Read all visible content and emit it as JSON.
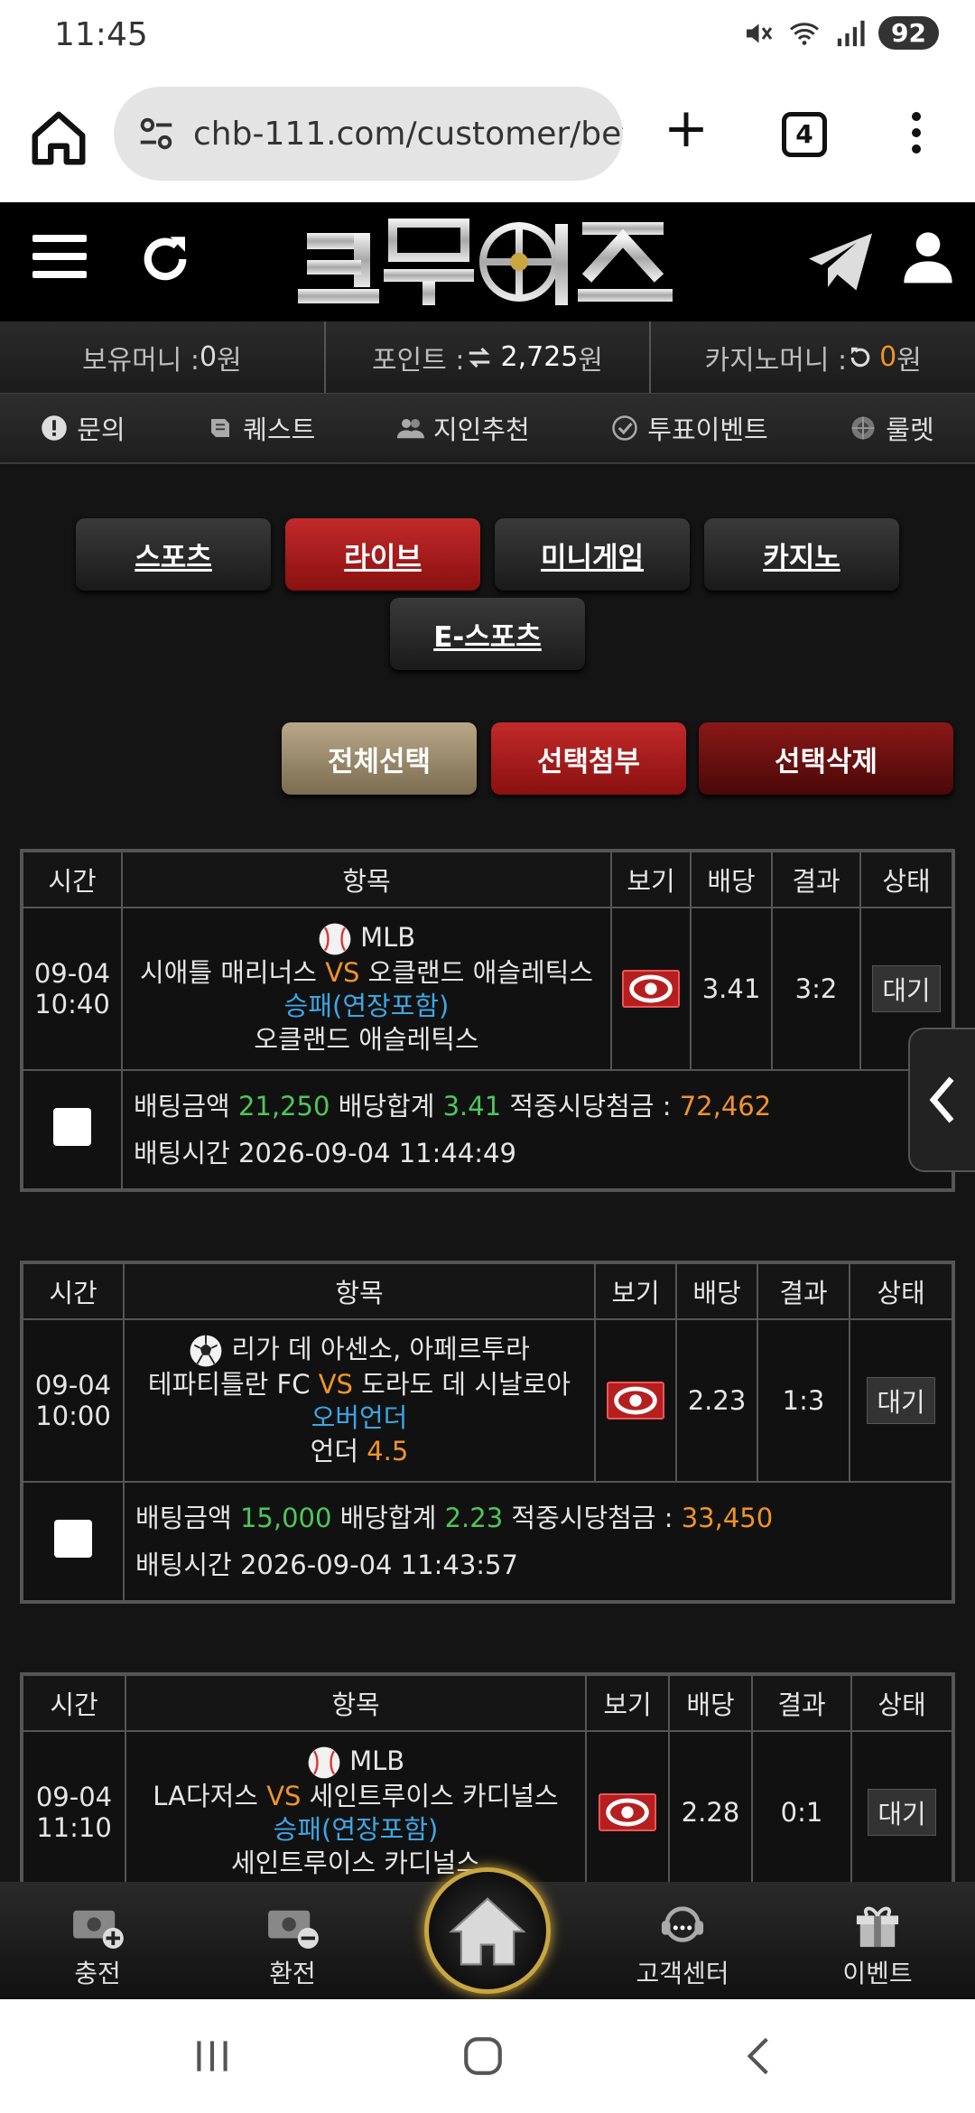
{
  "status_bar": {
    "time": "11:45",
    "battery": "92"
  },
  "browser": {
    "url": "chb-111.com/customer/bet_",
    "tab_count": "4"
  },
  "balances": {
    "hold_label": "보유머니 : ",
    "hold_value": "0",
    "hold_unit": " 원",
    "point_label": "포인트 : ",
    "point_value": "2,725",
    "point_unit": " 원",
    "casino_label": "카지노머니 : ",
    "casino_value": "0",
    "casino_unit": " 원"
  },
  "menu": [
    {
      "label": "문의",
      "icon": "info-icon"
    },
    {
      "label": "퀘스트",
      "icon": "quest-icon"
    },
    {
      "label": "지인추천",
      "icon": "friends-icon"
    },
    {
      "label": "투표이벤트",
      "icon": "vote-icon"
    },
    {
      "label": "룰렛",
      "icon": "roulette-icon"
    }
  ],
  "game_tabs": [
    "스포츠",
    "라이브",
    "미니게임",
    "카지노",
    "E-스포츠"
  ],
  "active_tab": "라이브",
  "actions": [
    "전체선택",
    "선택첨부",
    "선택삭제"
  ],
  "columns": [
    "시간",
    "항목",
    "보기",
    "배당",
    "결과",
    "상태"
  ],
  "bets": [
    {
      "date": "09-04",
      "time": "10:40",
      "league": "MLB",
      "sport_icon": "baseball-icon",
      "home": "시애틀 매리너스",
      "vs": "VS",
      "away": "오클랜드 애슬레틱스",
      "market": "승패(연장포함)",
      "pick": "오클랜드 애슬레틱스",
      "pick_extra": "",
      "odds": "3.41",
      "result": "3:2",
      "status": "대기",
      "amount_label": "배팅금액 ",
      "amount": "21,250",
      "odds_sum_label": " 배당합계 ",
      "odds_sum": "3.41",
      "payout_label": " 적중시당첨금 : ",
      "payout": "72,462",
      "bet_time": "배팅시간 2026-09-04 11:44:49"
    },
    {
      "date": "09-04",
      "time": "10:00",
      "league": "리가 데 아센소, 아페르투라",
      "sport_icon": "soccer-icon",
      "home": "테파티틀란 FC",
      "vs": "VS",
      "away": "도라도 데 시날로아",
      "market": "오버언더",
      "pick": "언더 ",
      "pick_extra": "4.5",
      "odds": "2.23",
      "result": "1:3",
      "status": "대기",
      "amount_label": "배팅금액 ",
      "amount": "15,000",
      "odds_sum_label": " 배당합계 ",
      "odds_sum": "2.23",
      "payout_label": " 적중시당첨금 : ",
      "payout": "33,450",
      "bet_time": "배팅시간 2026-09-04 11:43:57"
    },
    {
      "date": "09-04",
      "time": "11:10",
      "league": "MLB",
      "sport_icon": "baseball-icon",
      "home": "LA다저스",
      "vs": "VS",
      "away": "세인트루이스 카디널스",
      "market": "승패(연장포함)",
      "pick": "세인트루이스 카디널스",
      "pick_extra": "",
      "odds": "2.28",
      "result": "0:1",
      "status": "대기"
    }
  ],
  "bottom_nav": [
    {
      "label": "충전",
      "icon": "deposit-icon"
    },
    {
      "label": "환전",
      "icon": "withdraw-icon"
    },
    {
      "label": "",
      "icon": "home-icon"
    },
    {
      "label": "고객센터",
      "icon": "support-icon"
    },
    {
      "label": "이벤트",
      "icon": "gift-icon"
    }
  ],
  "colors": {
    "accent_red": "#b51f1f",
    "odds_green": "#4fc65a",
    "highlight_orange": "#f0932b",
    "market_blue": "#3ea6e6"
  }
}
